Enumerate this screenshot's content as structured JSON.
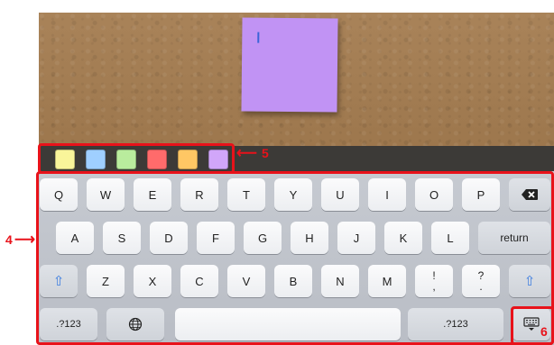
{
  "note": {
    "color": "#c193f4",
    "cursor_color": "#3b64d8"
  },
  "palette": {
    "colors": [
      "#f9f59a",
      "#9fcfff",
      "#b9ec9d",
      "#ff6b6b",
      "#ffc764",
      "#d1a6f9"
    ]
  },
  "keyboard": {
    "row1": [
      "Q",
      "W",
      "E",
      "R",
      "T",
      "Y",
      "U",
      "I",
      "O",
      "P"
    ],
    "row2": [
      "A",
      "S",
      "D",
      "F",
      "G",
      "H",
      "J",
      "K",
      "L"
    ],
    "row3": [
      "Z",
      "X",
      "C",
      "V",
      "B",
      "N",
      "M"
    ],
    "return_label": "return",
    "numbers_label": ".?123",
    "numbers_label_right": ".?123",
    "punct1_top": "!",
    "punct1_bottom": ",",
    "punct2_top": "?",
    "punct2_bottom": "."
  },
  "annotations": {
    "label_4": "4",
    "label_5": "5",
    "label_6": "6",
    "color": "#e8121a"
  }
}
